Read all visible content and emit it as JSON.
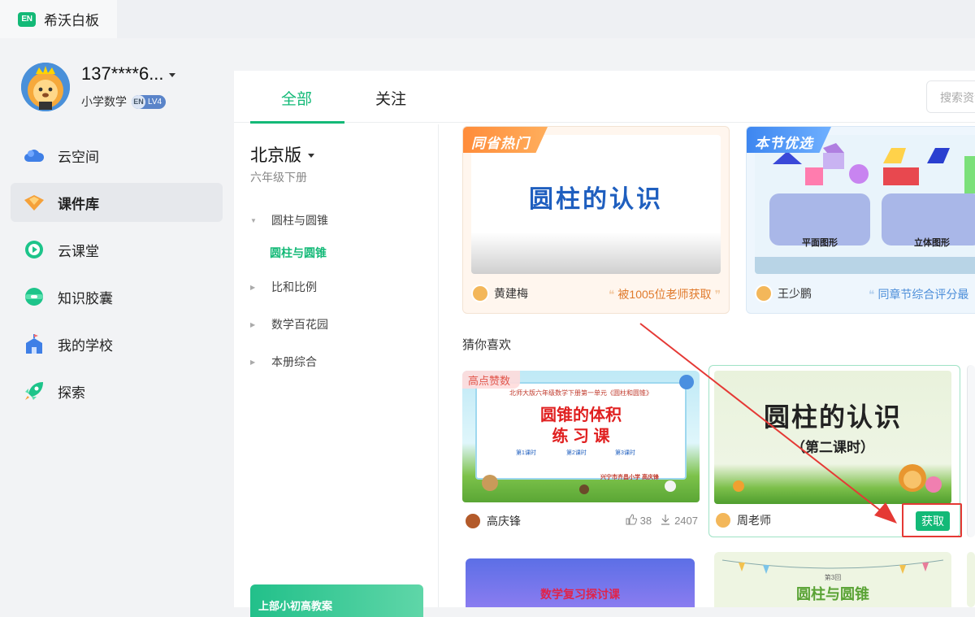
{
  "app": {
    "name": "希沃白板",
    "logo_text": "EN"
  },
  "user": {
    "name": "137****6...",
    "subject": "小学数学",
    "level": "LV4",
    "level_prefix": "EN"
  },
  "nav": {
    "items": [
      {
        "label": "云空间",
        "icon": "cloud-icon"
      },
      {
        "label": "课件库",
        "icon": "courseware-icon"
      },
      {
        "label": "云课堂",
        "icon": "play-icon"
      },
      {
        "label": "知识胶囊",
        "icon": "capsule-icon"
      },
      {
        "label": "我的学校",
        "icon": "school-icon"
      },
      {
        "label": "探索",
        "icon": "rocket-icon"
      }
    ],
    "active_index": 1
  },
  "tabs": [
    {
      "label": "全部"
    },
    {
      "label": "关注"
    }
  ],
  "search": {
    "placeholder": "搜索资源"
  },
  "tree": {
    "edition": "北京版",
    "grade": "六年级下册",
    "items": [
      {
        "label": "圆柱与圆锥",
        "expanded": true
      },
      {
        "label": "比和比例",
        "expanded": false
      },
      {
        "label": "数学百花园",
        "expanded": false
      },
      {
        "label": "本册综合",
        "expanded": false
      }
    ],
    "selected_sub": "圆柱与圆锥",
    "promo": "上部小初高教案"
  },
  "featured": [
    {
      "tag": "同省热门",
      "thumb_title": "圆柱的认识",
      "author": "黄建梅",
      "note": "被1005位老师获取"
    },
    {
      "tag": "本节优选",
      "thumb_labels": [
        "平面图形",
        "立体图形"
      ],
      "author": "王少鹏",
      "note": "同章节综合评分最"
    }
  ],
  "guess": {
    "title": "猜你喜欢",
    "cards": [
      {
        "badge": "高点赞数",
        "thumb_header": "北师大版六年级数学下册第一单元《圆柱和圆锥》",
        "thumb_title_1": "圆锥的体积",
        "thumb_title_2": "练 习 课",
        "thumb_lessons": [
          "第1课时",
          "第2课时",
          "第3课时"
        ],
        "thumb_school": "兴宁市齐昌小学 高庆锋",
        "author": "高庆锋",
        "likes": "38",
        "downloads": "2407"
      },
      {
        "thumb_title": "圆柱的认识",
        "thumb_subtitle": "（第二课时）",
        "author": "周老师",
        "action": "获取"
      }
    ],
    "bottom_cards": [
      {
        "thumb_title": "数学复习探讨课"
      },
      {
        "thumb_small": "第3回",
        "thumb_title": "圆柱与圆锥"
      }
    ]
  }
}
